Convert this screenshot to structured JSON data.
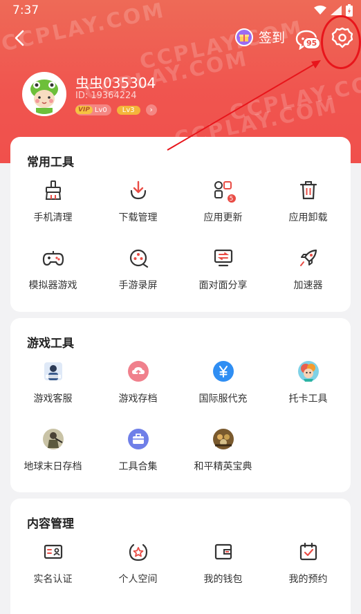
{
  "status": {
    "time": "7:37"
  },
  "header": {
    "checkin_label": "签到",
    "message_count": "95",
    "watermark": "CCPLAY.COM"
  },
  "user": {
    "name": "虫虫035304",
    "id": "ID: 19364224",
    "vip_label": "VIP",
    "vip_level": "Lv0",
    "level": "Lv3"
  },
  "common_tools": {
    "title": "常用工具",
    "items": [
      {
        "label": "手机清理",
        "icon": "broom-icon"
      },
      {
        "label": "下载管理",
        "icon": "download-icon"
      },
      {
        "label": "应用更新",
        "icon": "apps-update-icon",
        "badge": "5"
      },
      {
        "label": "应用卸载",
        "icon": "trash-icon"
      },
      {
        "label": "模拟器游戏",
        "icon": "gamepad-icon"
      },
      {
        "label": "手游录屏",
        "icon": "record-icon"
      },
      {
        "label": "面对面分享",
        "icon": "share-icon"
      },
      {
        "label": "加速器",
        "icon": "rocket-icon"
      }
    ]
  },
  "game_tools": {
    "title": "游戏工具",
    "items": [
      {
        "label": "游戏客服",
        "icon": "support-avatar-icon"
      },
      {
        "label": "游戏存档",
        "icon": "cloud-upload-icon",
        "color": "#f0808c"
      },
      {
        "label": "国际服代充",
        "icon": "yen-icon",
        "color": "#2f8ef3"
      },
      {
        "label": "托卡工具",
        "icon": "toca-avatar-icon"
      },
      {
        "label": "地球末日存档",
        "icon": "soldier-avatar-icon"
      },
      {
        "label": "工具合集",
        "icon": "toolbox-icon",
        "color": "#6f7fe8"
      },
      {
        "label": "和平精英宝典",
        "icon": "pubg-avatar-icon"
      }
    ]
  },
  "content_mgmt": {
    "title": "内容管理",
    "items": [
      {
        "label": "实名认证",
        "icon": "id-card-icon"
      },
      {
        "label": "个人空间",
        "icon": "star-circle-icon"
      },
      {
        "label": "我的钱包",
        "icon": "wallet-icon"
      },
      {
        "label": "我的预约",
        "icon": "calendar-check-icon"
      }
    ]
  },
  "colors": {
    "accent": "#f0554f",
    "annotation": "#e8151b"
  }
}
